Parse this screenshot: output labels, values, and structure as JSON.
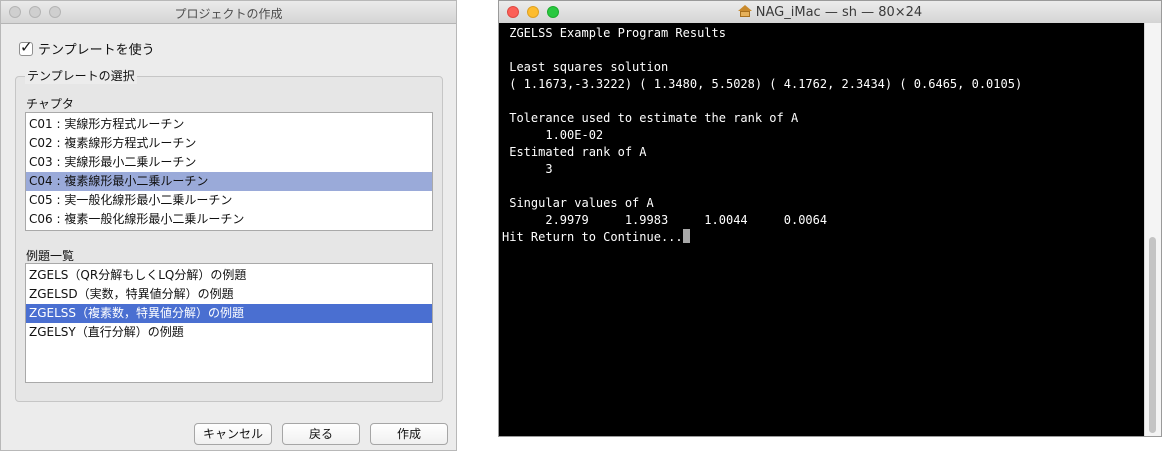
{
  "dialog": {
    "title": "プロジェクトの作成",
    "use_template_label": "テンプレートを使う",
    "template_group_label": "テンプレートの選択",
    "chapter_label": "チャプタ",
    "chapters": [
      "C01 : 実線形方程式ルーチン",
      "C02 : 複素線形方程式ルーチン",
      "C03 : 実線形最小二乗ルーチン",
      "C04 : 複素線形最小二乗ルーチン",
      "C05 : 実一般化線形最小二乗ルーチン",
      "C06 : 複素一般化線形最小二乗ルーチン"
    ],
    "examples_label": "例題一覧",
    "examples": [
      "ZGELS（QR分解もしくLQ分解）の例題",
      "ZGELSD（実数，特異値分解）の例題",
      "ZGELSS（複素数，特異値分解）の例題",
      "ZGELSY（直行分解）の例題"
    ],
    "buttons": {
      "cancel": "キャンセル",
      "back": "戻る",
      "create": "作成"
    }
  },
  "terminal": {
    "title": "NAG_iMac — sh — 80×24",
    "lines": [
      " ZGELSS Example Program Results",
      "",
      " Least squares solution",
      " ( 1.1673,-3.3222) ( 1.3480, 5.5028) ( 4.1762, 2.3434) ( 0.6465, 0.0105)",
      "",
      " Tolerance used to estimate the rank of A",
      "      1.00E-02",
      " Estimated rank of A",
      "      3",
      "",
      " Singular values of A",
      "      2.9979     1.9983     1.0044     0.0064"
    ],
    "prompt": "Hit Return to Continue..."
  },
  "colors": {
    "selection_light": "#9aaad9",
    "selection_strong": "#4a6fd1",
    "terminal_bg": "#000000",
    "terminal_fg": "#ffffff"
  },
  "icons": {
    "terminal_title": "home-icon",
    "checkbox": "checkmark-icon"
  }
}
